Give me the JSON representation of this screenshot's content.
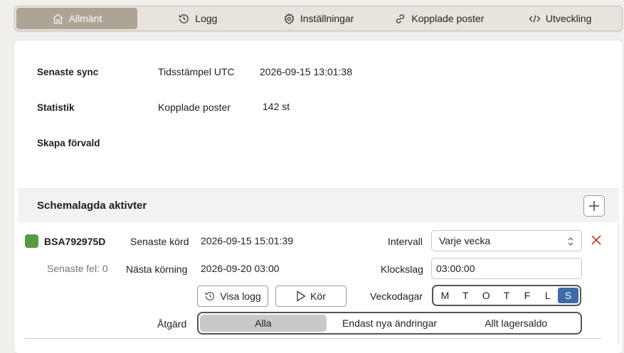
{
  "tabs": [
    {
      "label": "Allmänt",
      "icon": "home-icon",
      "active": true
    },
    {
      "label": "Logg",
      "icon": "history-icon",
      "active": false
    },
    {
      "label": "Inställningar",
      "icon": "gear-icon",
      "active": false
    },
    {
      "label": "Kopplade poster",
      "icon": "link-icon",
      "active": false
    },
    {
      "label": "Utveckling",
      "icon": "code-icon",
      "active": false
    }
  ],
  "info": {
    "last_sync_label": "Senaste sync",
    "timestamp_label": "Tidsstämpel UTC",
    "timestamp_value": "2026-09-15 13:01:38",
    "stats_label": "Statistik",
    "linked_label": "Kopplade poster",
    "linked_value": "142 st",
    "default_label": "Skapa förvald"
  },
  "schedule": {
    "title": "Schemalagda aktivter",
    "job": {
      "id": "BSA792975D",
      "status_color": "#5a9a3e",
      "last_error": "Senaste fel: 0",
      "last_run_label": "Senaste körd",
      "last_run_value": "2026-09-15 15:01:39",
      "next_run_label": "Nästa körning",
      "next_run_value": "2026-09-20 03:00",
      "interval_label": "Intervall",
      "interval_value": "Varje vecka",
      "clock_label": "Klockslag",
      "clock_value": "03:00:00",
      "show_log_label": "Visa logg",
      "run_label": "Kör",
      "weekdays_label": "Veckodagar",
      "weekdays": [
        "M",
        "T",
        "O",
        "T",
        "F",
        "L",
        "S"
      ],
      "selected_day_index": 6,
      "action_label": "Åtgärd",
      "actions": [
        "Alla",
        "Endast nya ändringar",
        "Allt lagersaldo"
      ],
      "selected_action_index": 0
    }
  },
  "colors": {
    "active_tab": "#aea496",
    "selected_day": "#3e6aa6",
    "delete": "#c0392b"
  }
}
